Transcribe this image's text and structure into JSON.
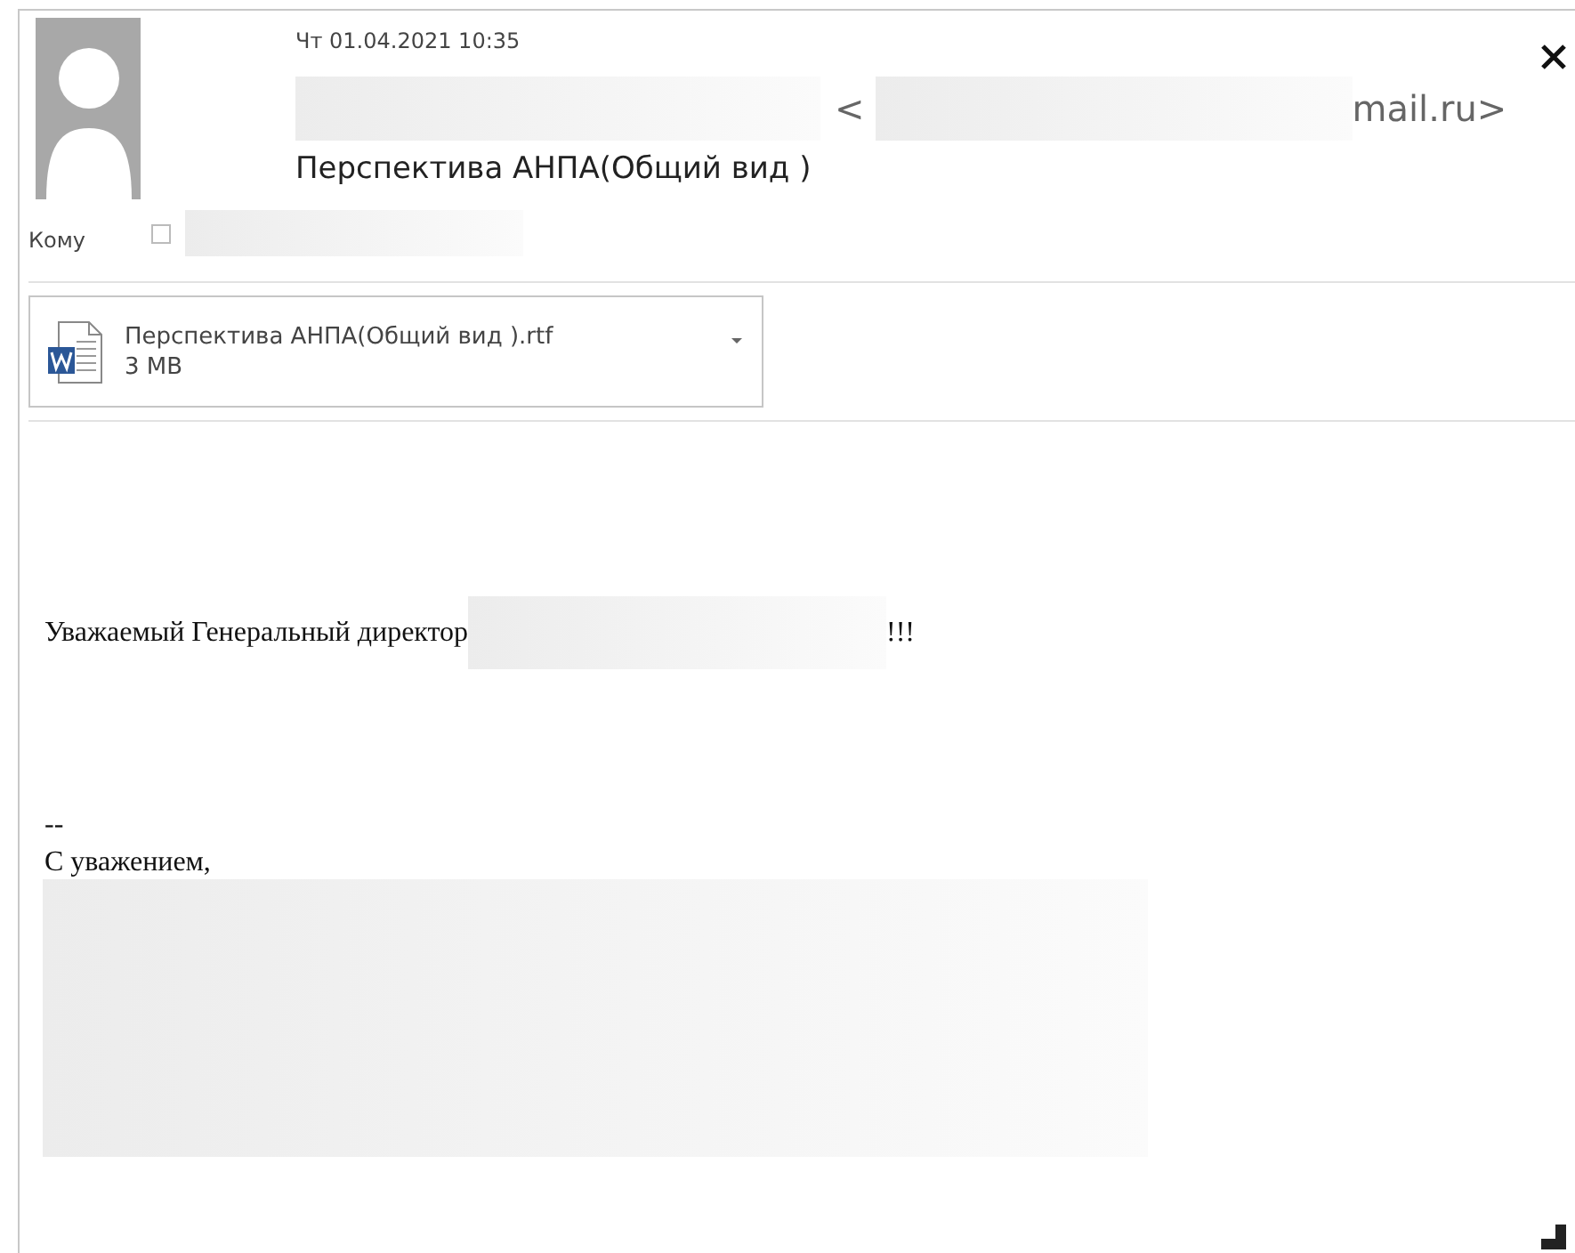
{
  "message": {
    "date": "Чт 01.04.2021 10:35",
    "sender_open": "<",
    "sender_domain": "mail.ru>",
    "subject": "Перспектива АНПА(Общий вид )",
    "to_label": "Кому"
  },
  "attachment": {
    "name": "Перспектива АНПА(Общий вид ).rtf",
    "size": "3 MB"
  },
  "body": {
    "greeting": "Уважаемый Генеральный директор",
    "greeting_end": "!!!",
    "separator": "--",
    "closing": "С уважением,"
  }
}
